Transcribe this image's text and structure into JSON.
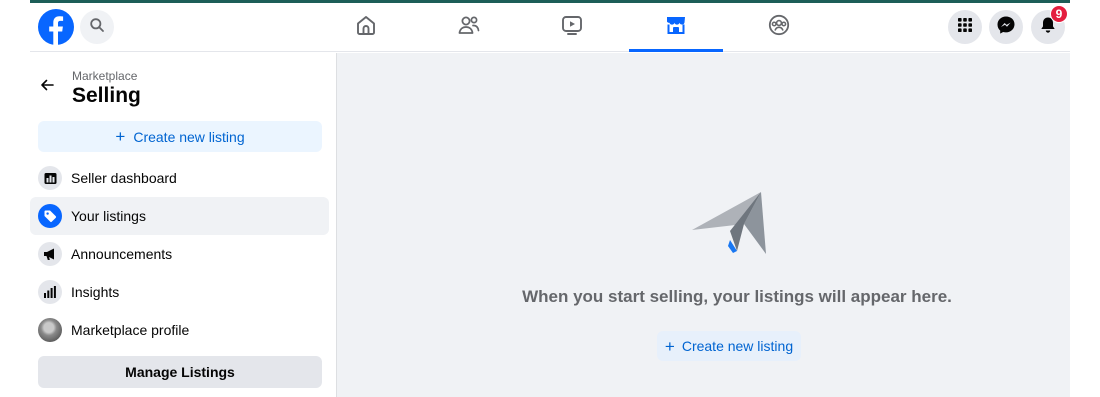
{
  "header": {
    "logo_icon": "facebook-logo-icon",
    "search_icon": "search-icon",
    "nav_tabs": [
      {
        "icon": "home-icon"
      },
      {
        "icon": "friends-icon"
      },
      {
        "icon": "video-icon"
      },
      {
        "icon": "marketplace-icon",
        "active": true
      },
      {
        "icon": "groups-icon"
      }
    ],
    "right_icons": [
      "menu-grid-icon",
      "messenger-icon",
      "bell-icon"
    ],
    "notification_count": "9"
  },
  "sidebar": {
    "breadcrumb": "Marketplace",
    "title": "Selling",
    "create_label": "Create new listing",
    "items": [
      {
        "label": "Seller dashboard",
        "icon": "dashboard-icon"
      },
      {
        "label": "Your listings",
        "icon": "tag-icon",
        "selected": true
      },
      {
        "label": "Announcements",
        "icon": "megaphone-icon"
      },
      {
        "label": "Insights",
        "icon": "bar-chart-icon"
      },
      {
        "label": "Marketplace profile",
        "icon": "profile-photo"
      }
    ],
    "manage_label": "Manage Listings"
  },
  "main": {
    "empty_message": "When you start selling, your listings will appear here.",
    "create_label": "Create new listing"
  },
  "colors": {
    "accent": "#0866ff",
    "link_text": "#0064d1",
    "light_button": "#ebf5ff",
    "page_bg": "#f0f2f5",
    "badge": "#e41e3f"
  }
}
